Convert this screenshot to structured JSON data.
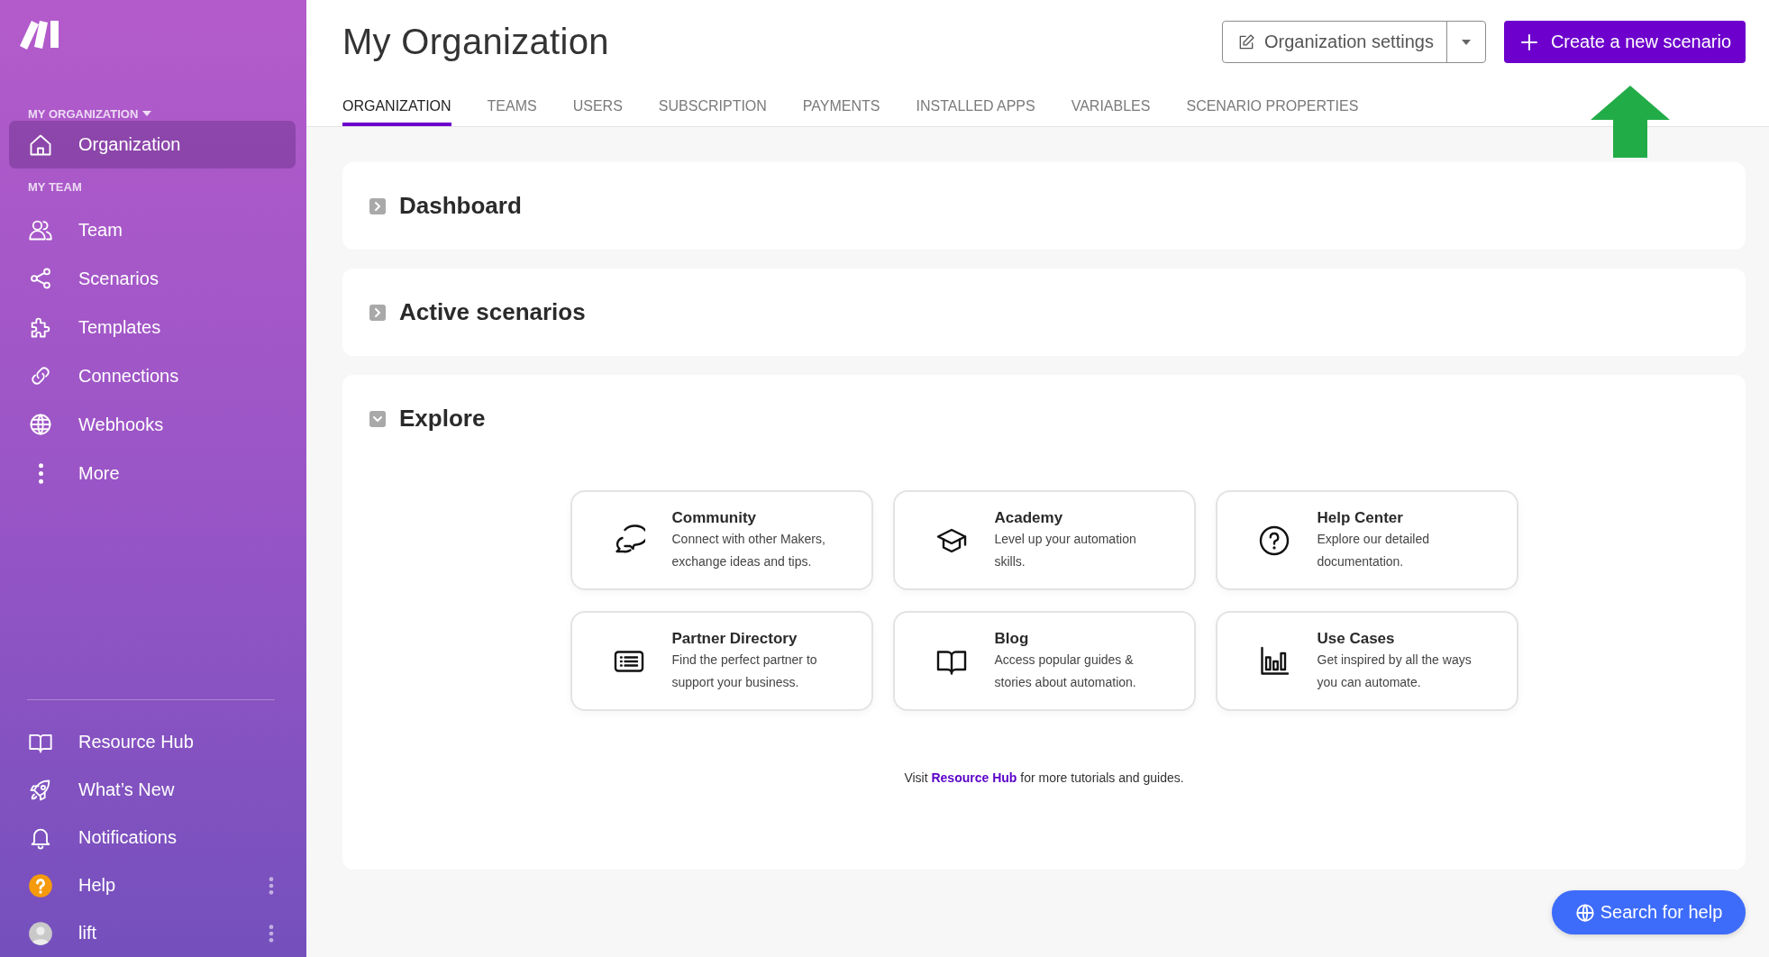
{
  "sidebar": {
    "org_label": "MY ORGANIZATION",
    "org_items": [
      {
        "label": "Organization",
        "selected": true
      }
    ],
    "team_label": "MY TEAM",
    "team_items": [
      {
        "label": "Team",
        "selected": false
      },
      {
        "label": "Scenarios",
        "selected": false
      },
      {
        "label": "Templates",
        "selected": false
      },
      {
        "label": "Connections",
        "selected": false
      },
      {
        "label": "Webhooks",
        "selected": false
      },
      {
        "label": "More",
        "selected": false
      }
    ],
    "bottom_items": [
      {
        "label": "Resource Hub",
        "menu": false
      },
      {
        "label": "What’s New",
        "menu": false
      },
      {
        "label": "Notifications",
        "menu": false
      },
      {
        "label": "Help",
        "menu": true
      },
      {
        "label": "lift",
        "menu": true
      }
    ]
  },
  "header": {
    "title": "My Organization",
    "settings_button": "Organization settings",
    "create_button": "Create a new scenario",
    "tabs": [
      {
        "label": "ORGANIZATION",
        "selected": true
      },
      {
        "label": "TEAMS",
        "selected": false
      },
      {
        "label": "USERS",
        "selected": false
      },
      {
        "label": "SUBSCRIPTION",
        "selected": false
      },
      {
        "label": "PAYMENTS",
        "selected": false
      },
      {
        "label": "INSTALLED APPS",
        "selected": false
      },
      {
        "label": "VARIABLES",
        "selected": false
      },
      {
        "label": "SCENARIO PROPERTIES",
        "selected": false
      }
    ]
  },
  "sections": [
    {
      "title": "Dashboard",
      "expanded": false
    },
    {
      "title": "Active scenarios",
      "expanded": false
    },
    {
      "title": "Explore",
      "expanded": true,
      "cards": [
        {
          "title": "Community",
          "text": "Connect with other Makers, exchange ideas and tips."
        },
        {
          "title": "Academy",
          "text": "Level up your automation skills."
        },
        {
          "title": "Help Center",
          "text": "Explore our detailed documentation."
        },
        {
          "title": "Partner Directory",
          "text": "Find the perfect partner to support your business."
        },
        {
          "title": "Blog",
          "text": "Access popular guides & stories about automation."
        },
        {
          "title": "Use Cases",
          "text": "Get inspired by all the ways you can automate."
        }
      ],
      "footer": {
        "before": "Visit",
        "link": "Resource Hub",
        "after": "for more tutorials and guides."
      }
    }
  ],
  "search_help": "Search for help"
}
